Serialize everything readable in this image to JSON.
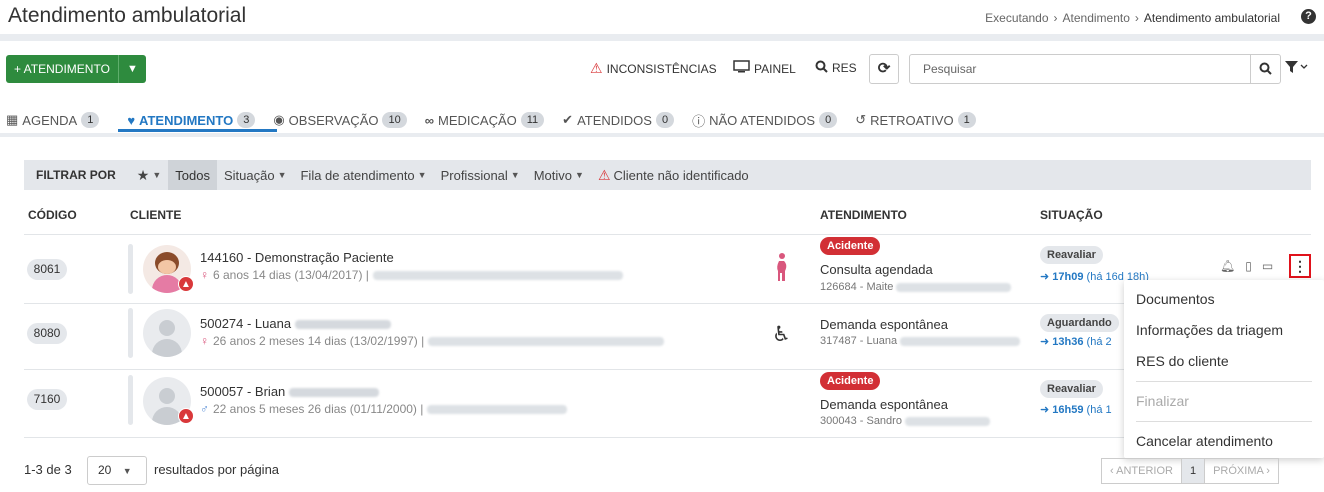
{
  "header": {
    "title": "Atendimento ambulatorial",
    "breadcrumb": [
      "Executando",
      "Atendimento",
      "Atendimento ambulatorial"
    ],
    "breadcrumb_sep": "›"
  },
  "toolbar": {
    "new_label": "+ ATENDIMENTO",
    "inconsistencias": "INCONSISTÊNCIAS",
    "painel": "PAINEL",
    "res": "RES",
    "search_placeholder": "Pesquisar"
  },
  "tabs": [
    {
      "label": "AGENDA",
      "count": "1",
      "icon": "calendar-icon"
    },
    {
      "label": "ATENDIMENTO",
      "count": "3",
      "icon": "heartbeat-icon"
    },
    {
      "label": "OBSERVAÇÃO",
      "count": "10",
      "icon": "eye-icon"
    },
    {
      "label": "MEDICAÇÃO",
      "count": "11",
      "icon": "binoculars-icon"
    },
    {
      "label": "ATENDIDOS",
      "count": "0",
      "icon": "check-circle-icon"
    },
    {
      "label": "NÃO ATENDIDOS",
      "count": "0",
      "icon": "info-circle-icon"
    },
    {
      "label": "RETROATIVO",
      "count": "1",
      "icon": "history-icon"
    }
  ],
  "filters": {
    "label": "FILTRAR POR",
    "todos": "Todos",
    "situacao": "Situação",
    "fila": "Fila de atendimento",
    "profissional": "Profissional",
    "motivo": "Motivo",
    "cliente": "Cliente não identificado"
  },
  "columns": {
    "codigo": "CÓDIGO",
    "cliente": "CLIENTE",
    "atendimento": "ATENDIMENTO",
    "situacao": "SITUAÇÃO"
  },
  "rows": [
    {
      "code": "8061",
      "name": "144160 - Demonstração Paciente",
      "info": "6 anos 14 dias (13/04/2017) |",
      "sex_symbol": "♀",
      "badge": "Acidente",
      "type": "Consulta agendada",
      "sub": "126684 - Maite",
      "status": "Reavaliar",
      "time": "17h09",
      "ago": "(há 16d 18h)"
    },
    {
      "code": "8080",
      "name": "500274 - Luana",
      "info": "26 anos 2 meses 14 dias (13/02/1997) |",
      "sex_symbol": "♀",
      "badge": "",
      "type": "Demanda espontânea",
      "sub": "317487 - Luana",
      "status": "Aguardando",
      "time": "13h36",
      "ago": "(há 2"
    },
    {
      "code": "7160",
      "name": "500057 - Brian",
      "info": "22 anos 5 meses 26 dias (01/11/2000) |",
      "sex_symbol": "♂",
      "badge": "Acidente",
      "type": "Demanda espontânea",
      "sub": "300043 - Sandro",
      "status": "Reavaliar",
      "time": "16h59",
      "ago": "(há 1"
    }
  ],
  "menu": {
    "items": [
      "Documentos",
      "Informações da triagem",
      "RES do cliente"
    ],
    "disabled": "Finalizar",
    "cancel": "Cancelar atendimento"
  },
  "footer": {
    "count": "1-3 de 3",
    "per_page": "20",
    "per_page_label": "resultados por página",
    "prev": "ANTERIOR",
    "page": "1",
    "next": "PRÓXIMA"
  },
  "colors": {
    "accent": "#2378c3",
    "success": "#2e8b3e",
    "danger": "#d22f35"
  }
}
